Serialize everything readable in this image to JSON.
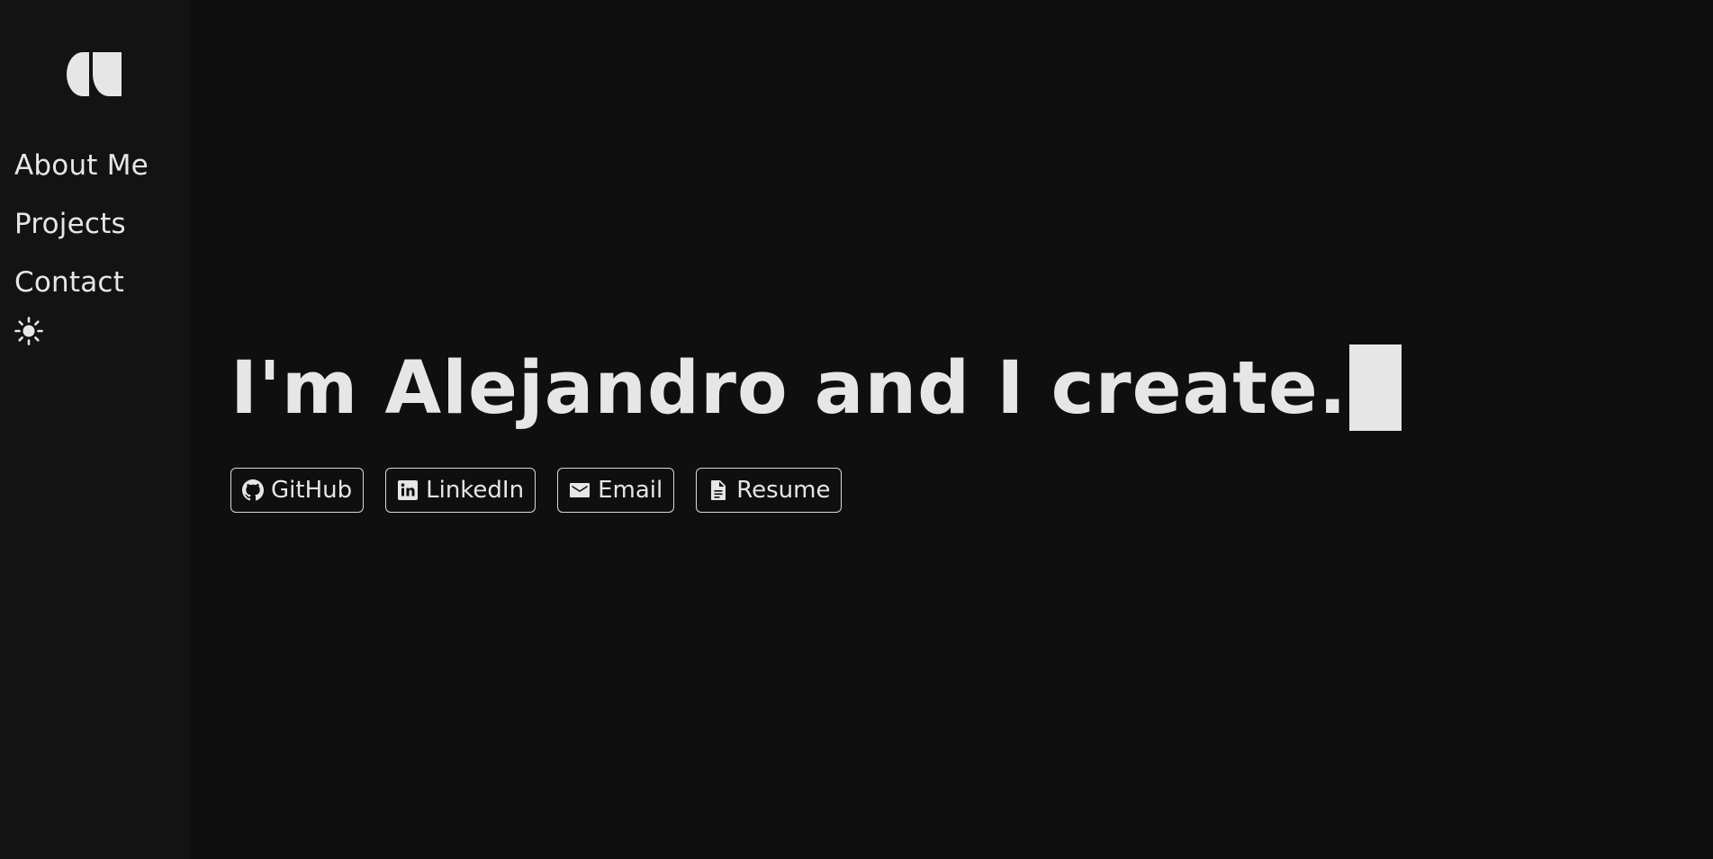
{
  "sidebar": {
    "logo": "logo-mark",
    "nav": [
      {
        "label": "About Me"
      },
      {
        "label": "Projects"
      },
      {
        "label": "Contact"
      }
    ],
    "theme_toggle_icon": "sun-icon"
  },
  "hero": {
    "headline": "I'm Alejandro and I create."
  },
  "links": [
    {
      "label": "GitHub",
      "icon": "github-icon"
    },
    {
      "label": "LinkedIn",
      "icon": "linkedin-icon"
    },
    {
      "label": "Email",
      "icon": "mail-icon"
    },
    {
      "label": "Resume",
      "icon": "document-icon"
    }
  ],
  "colors": {
    "background": "#0f0f0f",
    "sidebar": "#131313",
    "text": "#e6e6e6"
  }
}
